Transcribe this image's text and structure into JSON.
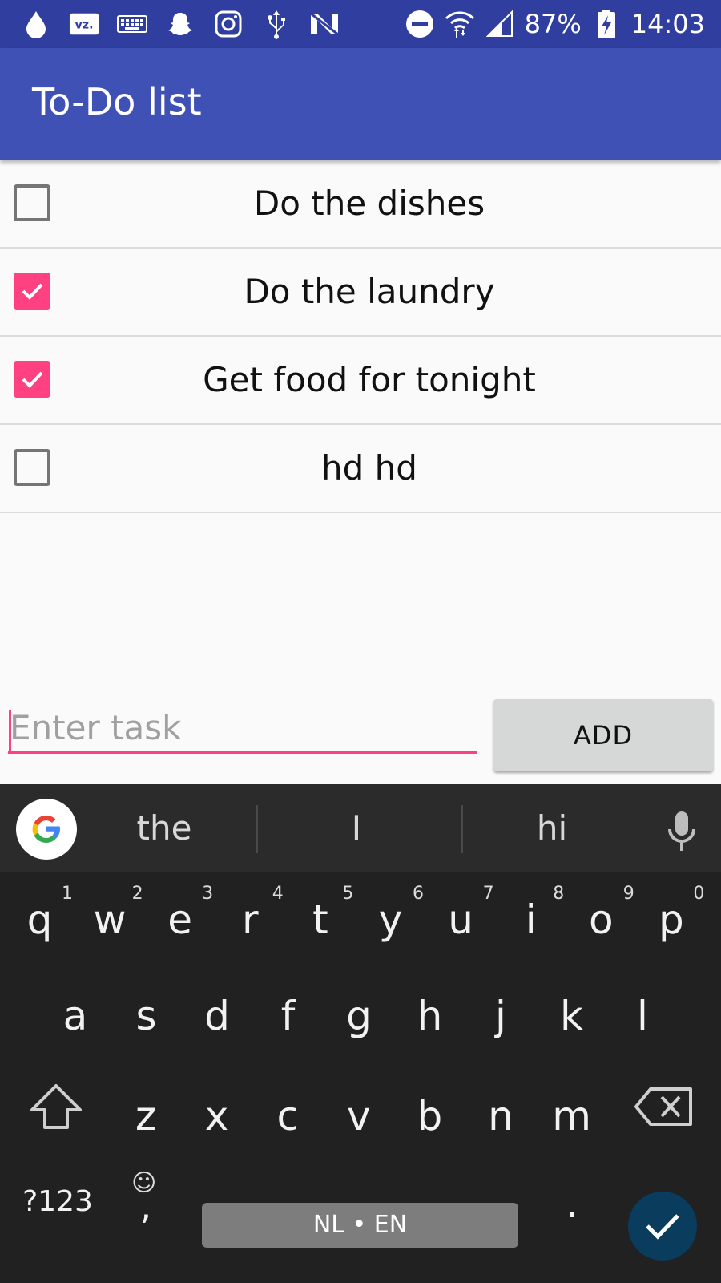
{
  "status_bar": {
    "battery": "87%",
    "time": "14:03",
    "left_icons": [
      "drop-icon",
      "vz-icon",
      "keyboard-icon",
      "snapchat-icon",
      "instagram-icon",
      "usb-icon",
      "n-icon"
    ],
    "right_icons": [
      "do-not-disturb-icon",
      "wifi-icon",
      "signal-icon",
      "battery-charging-icon"
    ],
    "vz_label": "vz."
  },
  "app_bar": {
    "title": "To-Do list"
  },
  "tasks": [
    {
      "label": "Do the dishes",
      "checked": false
    },
    {
      "label": "Do the laundry",
      "checked": true
    },
    {
      "label": "Get food for tonight",
      "checked": true
    },
    {
      "label": "hd hd",
      "checked": false
    }
  ],
  "input": {
    "placeholder": "Enter task",
    "value": ""
  },
  "add_button": {
    "label": "ADD"
  },
  "keyboard": {
    "suggestions": [
      "the",
      "I",
      "hi"
    ],
    "row1": [
      {
        "key": "q",
        "hint": "1"
      },
      {
        "key": "w",
        "hint": "2"
      },
      {
        "key": "e",
        "hint": "3"
      },
      {
        "key": "r",
        "hint": "4"
      },
      {
        "key": "t",
        "hint": "5"
      },
      {
        "key": "y",
        "hint": "6"
      },
      {
        "key": "u",
        "hint": "7"
      },
      {
        "key": "i",
        "hint": "8"
      },
      {
        "key": "o",
        "hint": "9"
      },
      {
        "key": "p",
        "hint": "0"
      }
    ],
    "row2": [
      "a",
      "s",
      "d",
      "f",
      "g",
      "h",
      "j",
      "k",
      "l"
    ],
    "row3": [
      "z",
      "x",
      "c",
      "v",
      "b",
      "n",
      "m"
    ],
    "symbols_key": "?123",
    "comma_key": ",",
    "space_label": "NL • EN",
    "period_key": ".",
    "accent_color": "#ff4081",
    "primary_color": "#3f51b5"
  }
}
